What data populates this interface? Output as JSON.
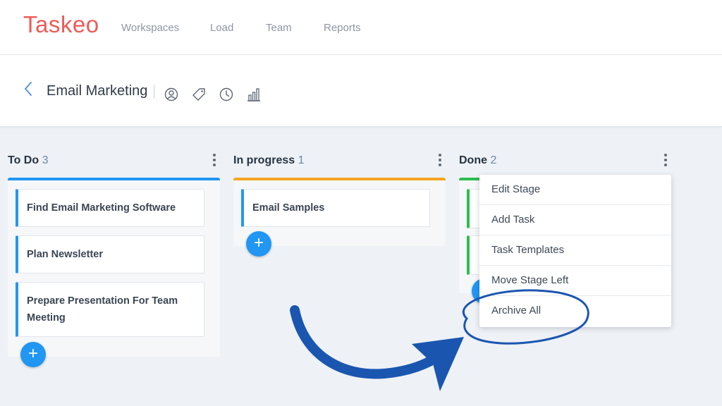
{
  "app": {
    "logo": "Taskeo"
  },
  "nav": [
    {
      "label": "Workspaces"
    },
    {
      "label": "Load"
    },
    {
      "label": "Team"
    },
    {
      "label": "Reports"
    }
  ],
  "project": {
    "title": "Email Marketing"
  },
  "toolbar_icons": [
    "users-icon",
    "tag-icon",
    "clock-icon",
    "bar-chart-icon"
  ],
  "columns": [
    {
      "title": "To Do",
      "count": "3",
      "accent": "#2196f3",
      "tasks": [
        "Find Email Marketing Software",
        "Plan Newsletter",
        "Prepare Presentation For Team Meeting"
      ]
    },
    {
      "title": "In progress",
      "count": "1",
      "accent": "#f5a623",
      "tasks": [
        "Email Samples"
      ]
    },
    {
      "title": "Done",
      "count": "2",
      "accent": "#2ebc4f",
      "tasks": []
    }
  ],
  "add_button": {
    "glyph": "+"
  },
  "stage_menu": {
    "items": [
      "Edit Stage",
      "Add Task",
      "Task Templates",
      "Move Stage Left",
      "Archive All"
    ]
  },
  "colors": {
    "brand": "#ee5b57",
    "primary": "#2196f3",
    "annotation": "#1a56b0"
  }
}
